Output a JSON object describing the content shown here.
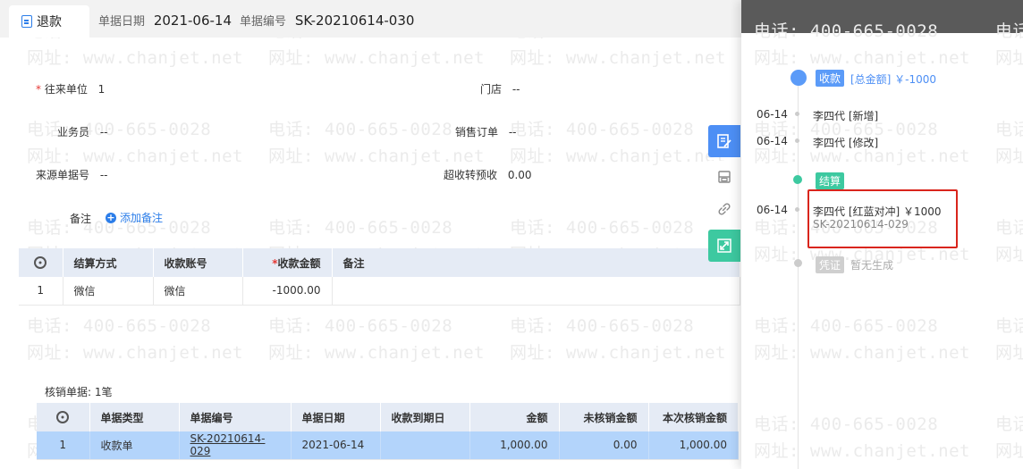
{
  "header": {
    "tab_label": "退款",
    "date_key": "单据日期",
    "date_value": "2021-06-14",
    "no_key": "单据编号",
    "no_value": "SK-20210614-030"
  },
  "form": {
    "partner_label": "往来单位",
    "partner_value": "1",
    "store_label": "门店",
    "store_value": "--",
    "salesman_label": "业务员",
    "salesman_value": "--",
    "sales_order_label": "销售订单",
    "sales_order_value": "--",
    "source_no_label": "来源单据号",
    "source_no_value": "--",
    "overpay_label": "超收转预收",
    "overpay_value": "0.00",
    "note_label": "备注",
    "add_note": "添加备注"
  },
  "settle_table": {
    "headers": [
      "结算方式",
      "收款账号",
      "收款金额",
      "备注"
    ],
    "rows": [
      {
        "idx": "1",
        "method": "微信",
        "account": "微信",
        "amount": "-1000.00",
        "note": ""
      }
    ]
  },
  "verify": {
    "caption": "核销单据: 1笔",
    "headers": [
      "单据类型",
      "单据编号",
      "单据日期",
      "收款到期日",
      "金额",
      "未核销金额",
      "本次核销金额"
    ],
    "rows": [
      {
        "idx": "1",
        "type": "收款单",
        "no": "SK-20210614-029",
        "date": "2021-06-14",
        "due": "",
        "amount": "1,000.00",
        "unverified": "0.00",
        "this": "1,000.00"
      }
    ]
  },
  "timeline": {
    "receive_badge": "收款",
    "total_amount": "[总金额] ￥-1000",
    "entries": [
      {
        "date": "06-14",
        "text": "李四代 [新增]"
      },
      {
        "date": "06-14",
        "text": "李四代 [修改]"
      }
    ],
    "settle_badge": "结算",
    "settle_entry": {
      "date": "06-14",
      "text": "李四代 [红蓝对冲]  ￥1000",
      "sub": "SK-20210614-029"
    },
    "voucher_badge": "凭证",
    "voucher_text": "暂无生成"
  },
  "watermark": {
    "phone": "电话: 400-665-0028",
    "site": "网址: www.chanjet.net"
  },
  "colors": {
    "accent": "#2b7de9",
    "table_header": "#e5ebf5",
    "selected_row": "#b3d4fb",
    "green": "#3dc9a0",
    "highlight": "#d9251c"
  }
}
